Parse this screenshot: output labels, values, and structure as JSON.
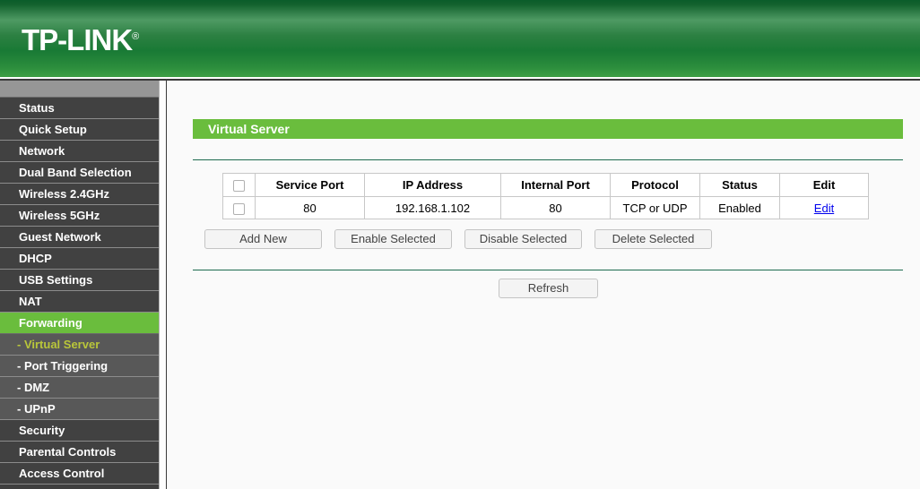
{
  "brand": {
    "name": "TP-LINK",
    "registered_mark": "®"
  },
  "sidebar": {
    "items": [
      {
        "label": "Status",
        "type": "top",
        "state": "normal"
      },
      {
        "label": "Quick Setup",
        "type": "top",
        "state": "normal"
      },
      {
        "label": "Network",
        "type": "top",
        "state": "normal"
      },
      {
        "label": "Dual Band Selection",
        "type": "top",
        "state": "normal"
      },
      {
        "label": "Wireless 2.4GHz",
        "type": "top",
        "state": "normal"
      },
      {
        "label": "Wireless 5GHz",
        "type": "top",
        "state": "normal"
      },
      {
        "label": "Guest Network",
        "type": "top",
        "state": "normal"
      },
      {
        "label": "DHCP",
        "type": "top",
        "state": "normal"
      },
      {
        "label": "USB Settings",
        "type": "top",
        "state": "normal"
      },
      {
        "label": "NAT",
        "type": "top",
        "state": "normal"
      },
      {
        "label": "Forwarding",
        "type": "top",
        "state": "active"
      },
      {
        "label": "- Virtual Server",
        "type": "sub",
        "state": "active"
      },
      {
        "label": "- Port Triggering",
        "type": "sub",
        "state": "normal"
      },
      {
        "label": "- DMZ",
        "type": "sub",
        "state": "normal"
      },
      {
        "label": "- UPnP",
        "type": "sub",
        "state": "normal"
      },
      {
        "label": "Security",
        "type": "top",
        "state": "normal"
      },
      {
        "label": "Parental Controls",
        "type": "top",
        "state": "normal"
      },
      {
        "label": "Access Control",
        "type": "top",
        "state": "normal"
      }
    ]
  },
  "main": {
    "page_title": "Virtual Server",
    "table": {
      "headers": [
        "",
        "Service Port",
        "IP Address",
        "Internal Port",
        "Protocol",
        "Status",
        "Edit"
      ],
      "rows": [
        {
          "selected": false,
          "service_port": "80",
          "ip_address": "192.168.1.102",
          "internal_port": "80",
          "protocol": "TCP or UDP",
          "status": "Enabled",
          "edit": "Edit"
        }
      ]
    },
    "buttons": {
      "add_new": "Add New",
      "enable_selected": "Enable Selected",
      "disable_selected": "Disable Selected",
      "delete_selected": "Delete Selected",
      "refresh": "Refresh"
    }
  },
  "colors": {
    "brand_green": "#6abd3d",
    "header_dark_green": "#0a5c2a",
    "sidebar_bg": "#414141",
    "sidebar_sub_bg": "#585858",
    "sub_active_text": "#b9c63a",
    "separator_green": "#1d6b4f",
    "link_blue": "#0000ee"
  }
}
